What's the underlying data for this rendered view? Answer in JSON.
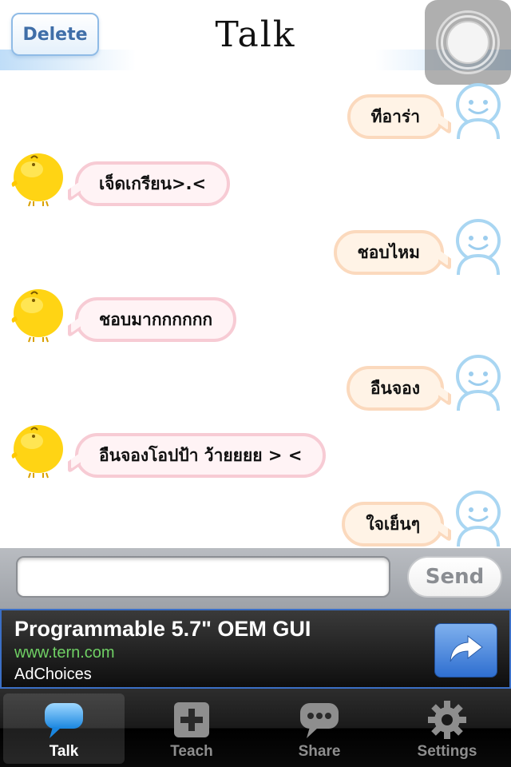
{
  "header": {
    "delete_label": "Delete",
    "title": "Talk"
  },
  "messages": [
    {
      "sender": "me",
      "text": "ทีอาร่า"
    },
    {
      "sender": "bot",
      "text": "เจ็ดเกรียน>.<"
    },
    {
      "sender": "me",
      "text": "ชอบไหม"
    },
    {
      "sender": "bot",
      "text": "ชอบมากกกกกก"
    },
    {
      "sender": "me",
      "text": "อืนจอง"
    },
    {
      "sender": "bot",
      "text": "อืนจองโอปป้า ว้ายยยย > <"
    },
    {
      "sender": "me",
      "text": "ใจเย็นๆ"
    }
  ],
  "composer": {
    "input_value": "",
    "send_label": "Send"
  },
  "ad": {
    "title": "Programmable 5.7\" OEM GUI",
    "url": "www.tern.com",
    "choices": "AdChoices"
  },
  "tabs": [
    {
      "label": "Talk",
      "icon": "speech-bubble-icon",
      "active": true
    },
    {
      "label": "Teach",
      "icon": "plus-box-icon",
      "active": false
    },
    {
      "label": "Share",
      "icon": "chat-dots-icon",
      "active": false
    },
    {
      "label": "Settings",
      "icon": "gear-icon",
      "active": false
    }
  ],
  "colors": {
    "me_bubble_border": "#fbd9bd",
    "bot_bubble_border": "#f7cbd4",
    "ad_url": "#6fd064",
    "tab_active": "#ffffff"
  }
}
